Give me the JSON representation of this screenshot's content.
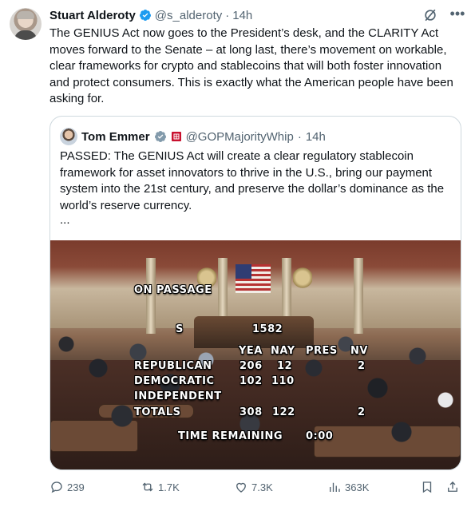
{
  "tweet": {
    "author_name": "Stuart Alderoty",
    "handle": "@s_alderoty",
    "separator": "·",
    "time": "14h",
    "text": "The GENIUS Act now goes to the President’s desk, and the CLARITY Act moves forward to the Senate – at long last, there’s movement on workable, clear frameworks for crypto and stablecoins that will both foster innovation and protect consumers. This is exactly what the American people have been asking for.",
    "verified_color": "#1d9bf0"
  },
  "quote": {
    "author_name": "Tom Emmer",
    "handle": "@GOPMajorityWhip",
    "separator": "·",
    "time": "14h",
    "text": "PASSED: The GENIUS Act will create a clear regulatory stablecoin framework for asset innovators to thrive in the U.S., bring our payment system into the 21st century, and preserve the dollar’s dominance as the world’s reserve currency.",
    "ellipsis": "...",
    "verified_color": "#829aab",
    "affiliation_badge_color": "#c8102e"
  },
  "vote_board": {
    "on_passage": "ON PASSAGE",
    "bill_prefix": "S",
    "bill_number": "1582",
    "col_yea": "YEA",
    "col_nay": "NAY",
    "col_pres": "PRES",
    "col_nv": "NV",
    "rows": [
      {
        "label": "REPUBLICAN",
        "yea": "206",
        "nay": "12",
        "pres": "",
        "nv": "2"
      },
      {
        "label": "DEMOCRATIC",
        "yea": "102",
        "nay": "110",
        "pres": "",
        "nv": ""
      },
      {
        "label": "INDEPENDENT",
        "yea": "",
        "nay": "",
        "pres": "",
        "nv": ""
      },
      {
        "label": "TOTALS",
        "yea": "308",
        "nay": "122",
        "pres": "",
        "nv": "2"
      }
    ],
    "time_remaining_label": "TIME REMAINING",
    "time_remaining_value": "0:00"
  },
  "actions": {
    "replies": "239",
    "reposts": "1.7K",
    "likes": "7.3K",
    "views": "363K"
  },
  "colors": {
    "text": "#0f1419",
    "secondary": "#536471",
    "border": "#cfd9de",
    "accent": "#1d9bf0"
  }
}
